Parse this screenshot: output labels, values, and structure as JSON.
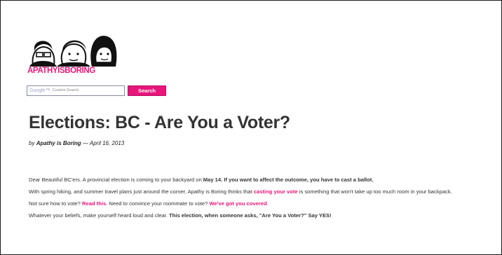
{
  "header": {
    "logo_text": "APATHYISBORING"
  },
  "search": {
    "google_label": "Google™",
    "placeholder": "Custom Search",
    "button_label": "Search"
  },
  "post": {
    "title": "Elections: BC - Are You a Voter?",
    "byline_prefix": "by",
    "author": "Apathy is Boring",
    "date": "— April 16, 2013"
  },
  "article": {
    "p1": {
      "text": "Dear Beautiful BC'ers. A provincial election is coming to your backyard on ",
      "date": "May 14.",
      "emph": " If you want to affect the outcome, you have to cast a ballot."
    },
    "p2": {
      "text1": "With spring hiking, and summer travel plans just around the corner, Apathy is Boring thinks that ",
      "link": "casting your vote",
      "text2": " is something that won't take up too much room in your backpack."
    },
    "p3": {
      "text1": "Not sure how to vote? ",
      "link1": "Read this",
      "text2": ". Need to convince your roommate to vote? ",
      "link2": "We've got you covered",
      "text3": "."
    },
    "p4": {
      "text": "Whatever your beliefs, make yourself heard loud and clear. ",
      "emph": "This election, when someone asks, \"Are You a Voter?\" Say YES!"
    }
  },
  "colors": {
    "brand_pink": "#e8157a",
    "title_color": "#333333"
  }
}
